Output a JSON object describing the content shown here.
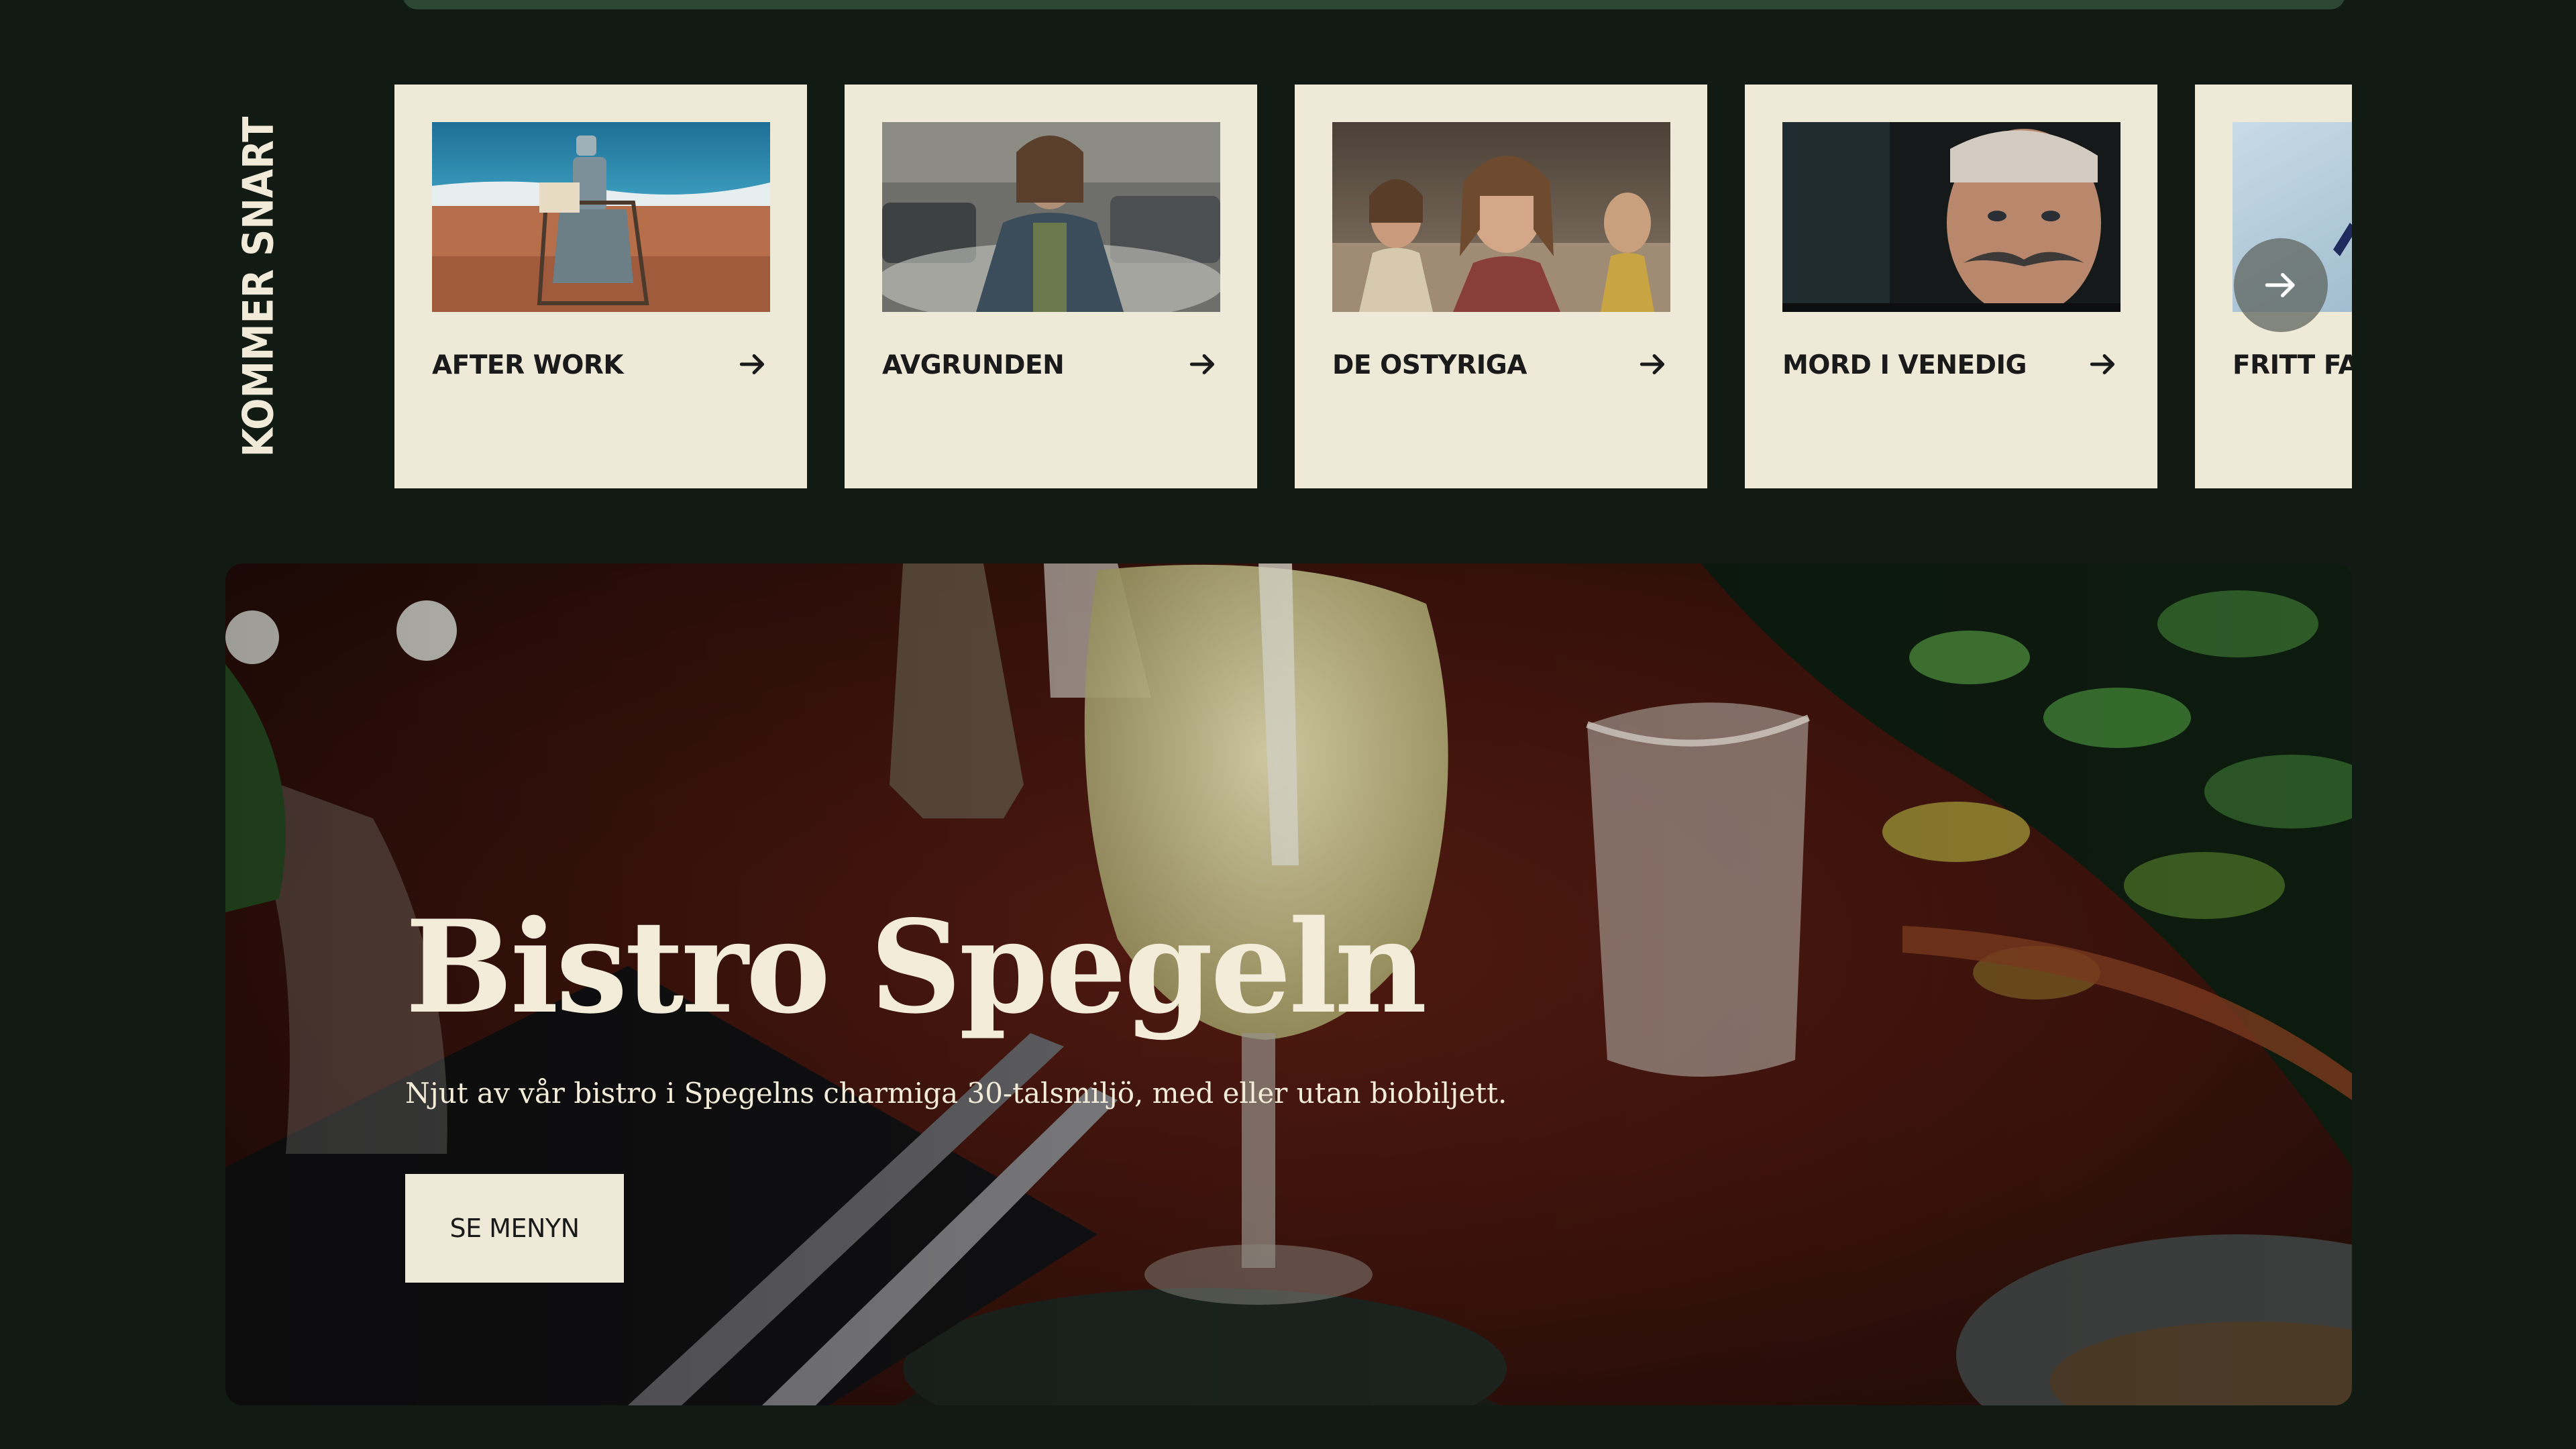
{
  "section": {
    "label": "KOMMER SNART"
  },
  "movies": [
    {
      "title": "AFTER WORK",
      "icon": "arrow-right-icon"
    },
    {
      "title": "AVGRUNDEN",
      "icon": "arrow-right-icon"
    },
    {
      "title": "DE OSTYRIGA",
      "icon": "arrow-right-icon"
    },
    {
      "title": "MORD I VENEDIG",
      "icon": "arrow-right-icon"
    },
    {
      "title": "FRITT FALL",
      "icon": "arrow-right-icon"
    }
  ],
  "carousel": {
    "next_icon": "arrow-right-icon"
  },
  "bistro": {
    "title": "Bistro Spegeln",
    "description": "Njut av vår bistro i Spegelns charmiga 30-talsmiljö, med eller utan biobiljett.",
    "button_label": "SE MENYN"
  },
  "colors": {
    "background": "#111b13",
    "card": "#efe9d8",
    "text_light": "#f3ecd9",
    "text_dark": "#1a1a1a"
  }
}
